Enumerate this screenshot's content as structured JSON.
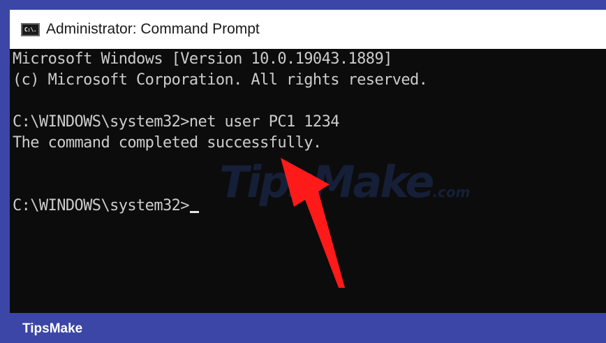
{
  "window": {
    "title": "Administrator: Command Prompt",
    "icon": "cmd-icon",
    "icon_text": "C:\\."
  },
  "console": {
    "lines": [
      "Microsoft Windows [Version 10.0.19043.1889]",
      "(c) Microsoft Corporation. All rights reserved.",
      "C:\\WINDOWS\\system32>net user PC1 1234",
      "The command completed successfully.",
      "C:\\WINDOWS\\system32>"
    ]
  },
  "watermark": {
    "text": "TipsMake",
    "suffix": ".com"
  },
  "annotation": {
    "arrow_color": "#ff1a1a",
    "icon": "red-arrow-icon"
  },
  "footer": {
    "brand": "TipsMake"
  },
  "colors": {
    "frame": "#3b46a6",
    "console_bg": "#0c0c0c",
    "console_text": "#cccccc",
    "titlebar_bg": "#ffffff"
  }
}
